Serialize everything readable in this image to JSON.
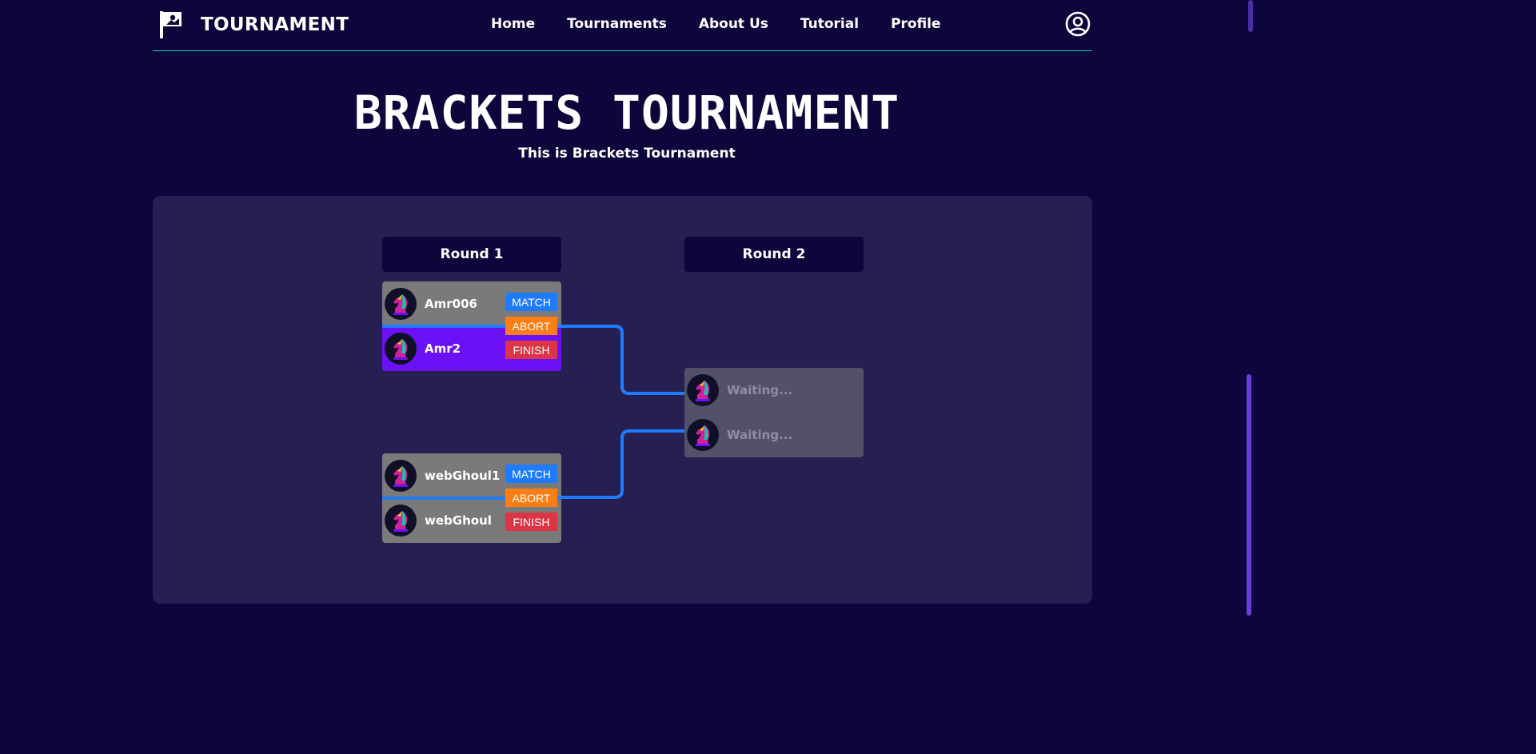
{
  "header": {
    "brand": "TOURNAMENT",
    "nav": [
      "Home",
      "Tournaments",
      "About Us",
      "Tutorial",
      "Profile"
    ]
  },
  "hero": {
    "title": "BRACKETS TOURNAMENT",
    "subtitle": "This is Brackets Tournament"
  },
  "bracket": {
    "rounds": [
      "Round 1",
      "Round 2"
    ],
    "round1_matches": [
      {
        "player1": "Amr006",
        "player2": "Amr2",
        "buttons": {
          "match": "MATCH",
          "abort": "ABORT",
          "finish": "FINISH"
        }
      },
      {
        "player1": "webGhoul1",
        "player2": "webGhoul",
        "buttons": {
          "match": "MATCH",
          "abort": "ABORT",
          "finish": "FINISH"
        }
      }
    ],
    "round2_matches": [
      {
        "player1": "Waiting...",
        "player2": "Waiting..."
      }
    ]
  },
  "colors": {
    "background": "#0d063d",
    "panel": "#261f52",
    "accent_line": "#1ec6d8",
    "connector": "#1f7bff",
    "winner": "#6a11f5",
    "match_button": "#1f7bff",
    "abort_button": "#fd7e14",
    "finish_button": "#dc3545"
  },
  "icons": {
    "brand": "flag-icon",
    "profile": "user-circle-icon",
    "avatar": "knight-chess-piece-icon"
  }
}
